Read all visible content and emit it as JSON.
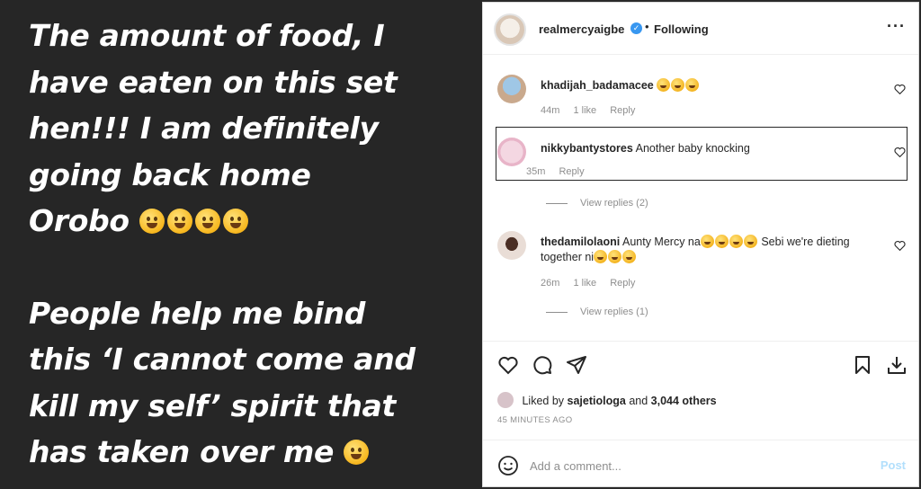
{
  "story": {
    "lines": [
      "The amount of food, I",
      "have eaten on this set",
      "hen!!! I am definitely",
      "going back home",
      "Orobo",
      "People help me bind",
      "this ‘I cannot come and",
      "kill my self’ spirit that",
      "has taken over me"
    ]
  },
  "post": {
    "username": "realmercyaigbe",
    "separator": "•",
    "follow_status": "Following",
    "more_icon": "more-horizontal-icon"
  },
  "comments": [
    {
      "user": "khadijah_badamacee",
      "text": "",
      "time": "44m",
      "likes": "1 like",
      "reply": "Reply"
    },
    {
      "user": "nikkybantystores",
      "text": "Another baby knocking",
      "time": "35m",
      "likes": "",
      "reply": "Reply",
      "view_replies": "View replies (2)"
    },
    {
      "user": "thedamilolaoni",
      "text": "Aunty Mercy na",
      "text2": "Sebi we're dieting together ni",
      "time": "26m",
      "likes": "1 like",
      "reply": "Reply",
      "view_replies": "View replies (1)"
    }
  ],
  "actions": {
    "liked_by_prefix": "Liked by",
    "liked_by_user": "sajetiologa",
    "liked_and": "and",
    "liked_others": "3,044 others",
    "time_ago": "45 MINUTES AGO"
  },
  "add_comment": {
    "placeholder": "Add a comment...",
    "post_label": "Post"
  },
  "colors": {
    "accent": "#0095f6",
    "post_disabled": "#b2dffc",
    "muted": "#8e8e8e"
  }
}
